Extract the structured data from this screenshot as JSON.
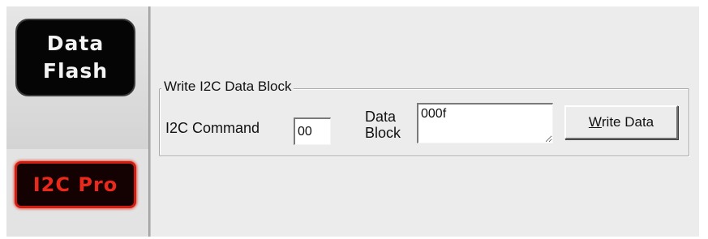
{
  "sidebar": {
    "data_flash_label_line1": "Data",
    "data_flash_label_line2": "Flash",
    "i2c_pro_label": "I2C Pro"
  },
  "write_block": {
    "group_title": "Write I2C Data Block",
    "command_label": "I2C Command",
    "command_value": "00",
    "data_block_label_line1": "Data",
    "data_block_label_line2": "Block",
    "data_block_value": "000f",
    "write_button_accel": "W",
    "write_button_rest": "rite Data"
  },
  "colors": {
    "i2c_pro_accent": "#e8291c",
    "data_flash_bg": "#050505",
    "panel_bg": "#ececec"
  }
}
